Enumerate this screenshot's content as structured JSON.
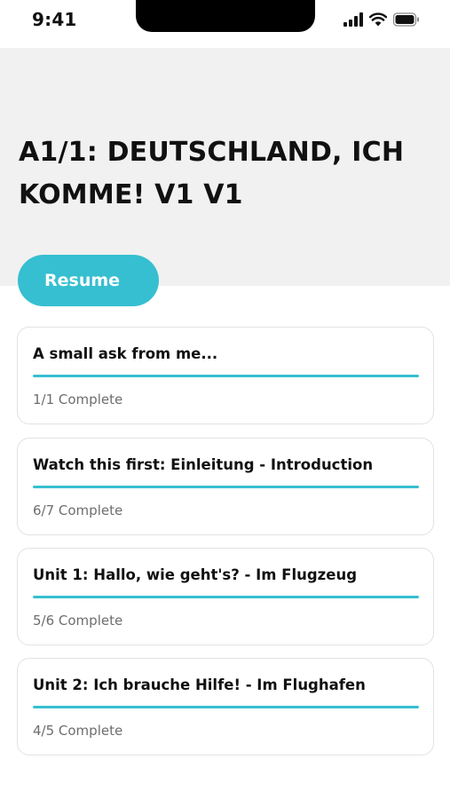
{
  "status_bar": {
    "time": "9:41"
  },
  "course": {
    "title": "A1/1: DEUTSCHLAND, ICH KOMME! v1 v1"
  },
  "actions": {
    "resume_label": "Resume"
  },
  "colors": {
    "accent": "#36bfd0",
    "header_bg": "#f1f1f1"
  },
  "lessons": [
    {
      "title": "A small ask from me...",
      "status": "1/1 Complete",
      "progress": 1.0
    },
    {
      "title": "Watch this first: Einleitung - Introduction",
      "status": "6/7 Complete",
      "progress": 1.0
    },
    {
      "title": "Unit 1: Hallo, wie geht's? - Im Flugzeug",
      "status": "5/6 Complete",
      "progress": 1.0
    },
    {
      "title": "Unit 2: Ich brauche Hilfe! - Im Flughafen",
      "status": "4/5 Complete",
      "progress": 1.0
    }
  ]
}
